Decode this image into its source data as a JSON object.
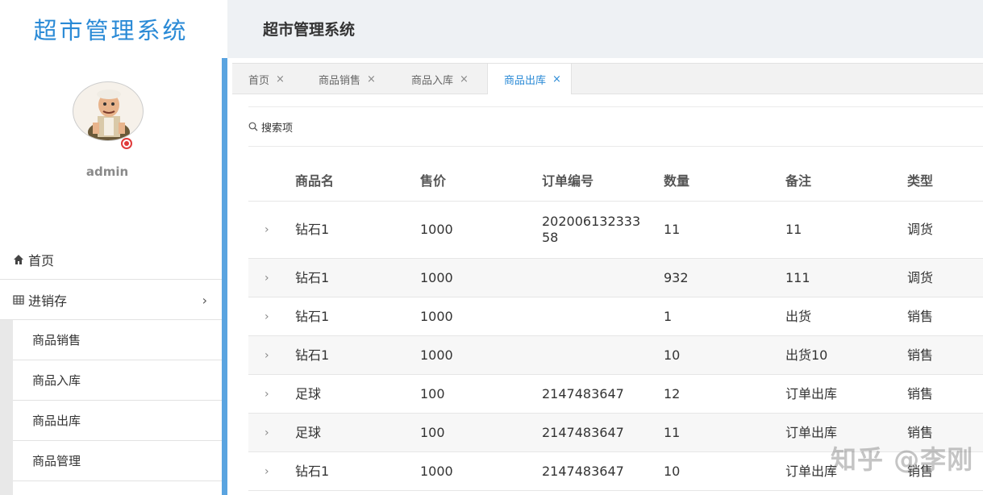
{
  "app": {
    "logo": "超市管理系统",
    "header_title": "超市管理系统"
  },
  "user": {
    "name": "admin"
  },
  "menu": {
    "home": "首页",
    "inventory": "进销存",
    "subitems": [
      "商品销售",
      "商品入库",
      "商品出库",
      "商品管理"
    ]
  },
  "tabs": [
    {
      "label": "首页",
      "close": "×"
    },
    {
      "label": "商品销售",
      "close": "×"
    },
    {
      "label": "商品入库",
      "close": "×"
    },
    {
      "label": "商品出库",
      "close": "×"
    }
  ],
  "search": {
    "label": "搜索项"
  },
  "table": {
    "headers": [
      "商品名",
      "售价",
      "订单编号",
      "数量",
      "备注",
      "类型"
    ],
    "rows": [
      {
        "name": "钻石1",
        "price": "1000",
        "order": "20200613233358",
        "qty": "11",
        "note": "11",
        "type": "调货"
      },
      {
        "name": "钻石1",
        "price": "1000",
        "order": "",
        "qty": "932",
        "note": "111",
        "type": "调货"
      },
      {
        "name": "钻石1",
        "price": "1000",
        "order": "",
        "qty": "1",
        "note": "出货",
        "type": "销售"
      },
      {
        "name": "钻石1",
        "price": "1000",
        "order": "",
        "qty": "10",
        "note": "出货10",
        "type": "销售"
      },
      {
        "name": "足球",
        "price": "100",
        "order": "2147483647",
        "qty": "12",
        "note": "订单出库",
        "type": "销售"
      },
      {
        "name": "足球",
        "price": "100",
        "order": "2147483647",
        "qty": "11",
        "note": "订单出库",
        "type": "销售"
      },
      {
        "name": "钻石1",
        "price": "1000",
        "order": "2147483647",
        "qty": "10",
        "note": "订单出库",
        "type": "销售"
      }
    ]
  },
  "watermark": "知乎 @李刚",
  "colors": {
    "accent": "#2a8ad6",
    "scrollbar": "#5aa4e0",
    "header_bg": "#eef1f4"
  }
}
